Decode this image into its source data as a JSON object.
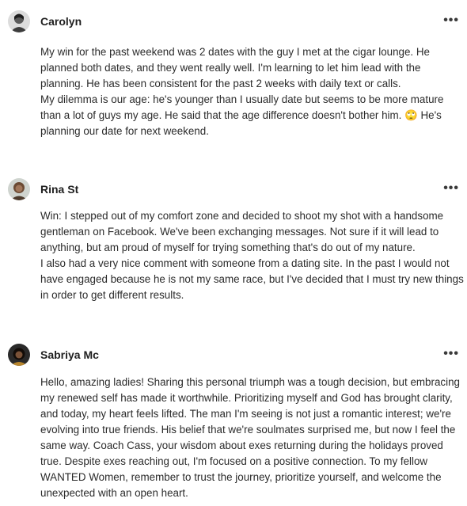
{
  "posts": [
    {
      "author": "Carolyn",
      "more_icon": "•••",
      "paragraphs": [
        "My win for the past weekend was 2 dates with the guy I met at the cigar lounge. He planned both dates, and they went really well. I'm learning to let him lead with the planning. He has been consistent for the past 2 weeks with daily text or calls.",
        "My dilemma is our age: he's younger than I usually date but seems to be more mature than a lot of guys my age. He said that the age difference doesn't bother him. 🙄 He's planning our date for next weekend."
      ]
    },
    {
      "author": "Rina St",
      "more_icon": "•••",
      "paragraphs": [
        "Win: I stepped out of my comfort zone and decided to shoot my shot with a handsome gentleman on Facebook. We've been exchanging messages. Not sure if it will lead to anything, but am proud of myself for trying something that's do out of my nature.",
        "I also had a very nice comment with someone from a dating site. In the past I would not have engaged because he is not my same race, but I've decided that I must try new things in order to get different results."
      ]
    },
    {
      "author": "Sabriya Mc",
      "more_icon": "•••",
      "paragraphs": [
        "Hello, amazing ladies! Sharing this personal triumph was a tough decision, but embracing my renewed self has made it worthwhile. Prioritizing myself and God has brought clarity, and today, my heart feels lifted. The man I'm seeing is not just a romantic interest; we're evolving into true friends. His belief that we're soulmates surprised me, but now I feel the same way. Coach Cass, your wisdom about exes returning during the holidays proved true. Despite exes reaching out, I'm focused on a positive connection. To my fellow WANTED Women, remember to trust the journey, prioritize yourself, and welcome the unexpected with an open heart."
      ]
    }
  ]
}
